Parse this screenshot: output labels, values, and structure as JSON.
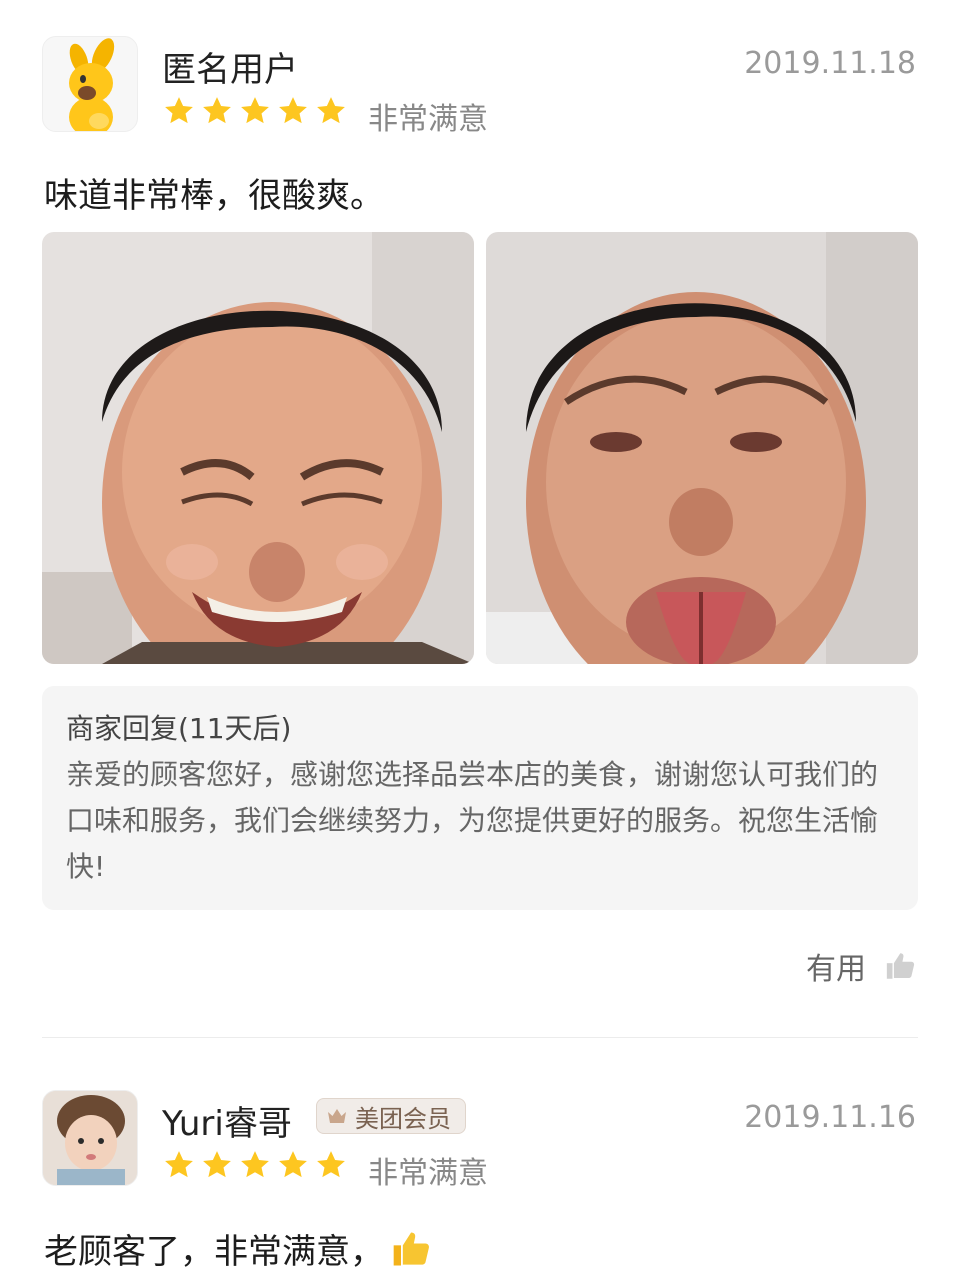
{
  "reviews": [
    {
      "username": "匿名用户",
      "date": "2019.11.18",
      "rating_text": "非常满意",
      "stars": 5,
      "text": "味道非常棒，很酸爽。",
      "merchant_reply": {
        "title": "商家回复(11天后)",
        "body": "亲爱的顾客您好，感谢您选择品尝本店的美食，谢谢您认可我们的口味和服务，我们会继续努力，为您提供更好的服务。祝您生活愉快!"
      },
      "useful_label": "有用"
    },
    {
      "username": "Yuri睿哥",
      "badge": "美团会员",
      "date": "2019.11.16",
      "rating_text": "非常满意",
      "stars": 5,
      "text": "老顾客了，非常满意，"
    }
  ],
  "colors": {
    "star": "#fdc620",
    "badge_bg": "#f1ece8",
    "reply_bg": "#f5f5f5",
    "date": "#9a9a9a"
  },
  "icons": {
    "avatar_1": "yellow-kangaroo-mascot",
    "avatar_2": "child-photo",
    "useful": "thumbs-up-icon",
    "emoji": "thumbs-up-emoji",
    "badge": "crown-icon"
  }
}
